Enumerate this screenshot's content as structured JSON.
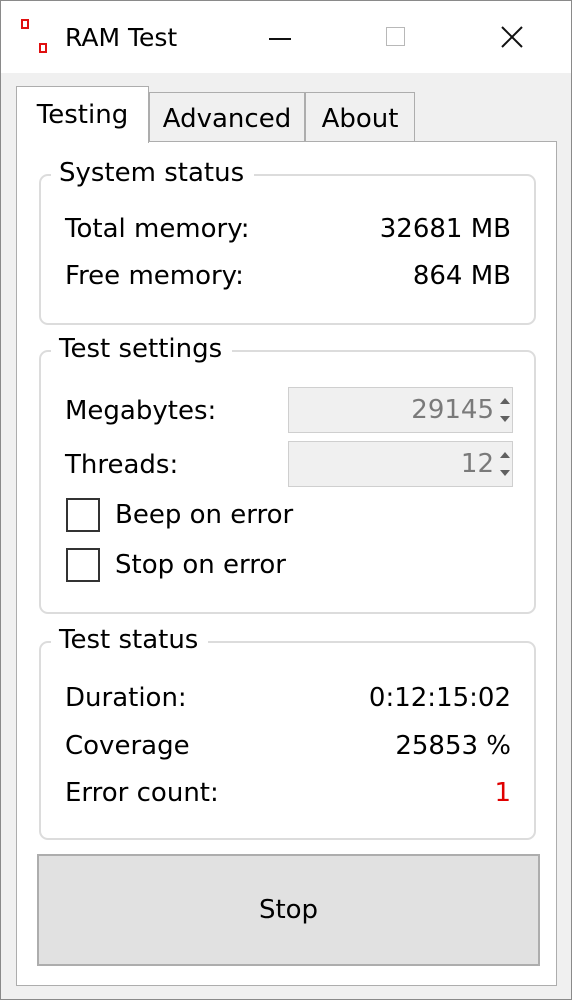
{
  "window": {
    "title": "RAM Test",
    "accent_color": "#e01010"
  },
  "tabs": [
    {
      "label": "Testing",
      "selected": true
    },
    {
      "label": "Advanced",
      "selected": false
    },
    {
      "label": "About",
      "selected": false
    }
  ],
  "system_status": {
    "legend": "System status",
    "total_memory_label": "Total memory:",
    "total_memory_value": "32681 MB",
    "free_memory_label": "Free memory:",
    "free_memory_value": "864 MB"
  },
  "test_settings": {
    "legend": "Test settings",
    "megabytes_label": "Megabytes:",
    "megabytes_value": "29145",
    "threads_label": "Threads:",
    "threads_value": "12",
    "beep_on_error_label": "Beep on error",
    "beep_on_error_checked": false,
    "stop_on_error_label": "Stop on error",
    "stop_on_error_checked": false
  },
  "test_status": {
    "legend": "Test status",
    "duration_label": "Duration:",
    "duration_value": "0:12:15:02",
    "coverage_label": "Coverage",
    "coverage_value": "25853 %",
    "error_count_label": "Error count:",
    "error_count_value": "1",
    "error_color": "#e00000"
  },
  "actions": {
    "stop_label": "Stop"
  }
}
